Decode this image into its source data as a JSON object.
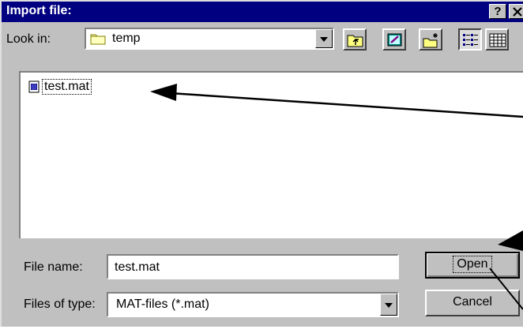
{
  "window": {
    "title": "Import file:",
    "help_label": "?",
    "close_label": "X"
  },
  "look_in": {
    "label": "Look in:",
    "value": "temp"
  },
  "toolbar": {
    "icons": [
      "up-one-level-icon",
      "desktop-icon",
      "new-folder-icon",
      "list-view-icon",
      "details-view-icon"
    ]
  },
  "files": [
    {
      "name": "test.mat",
      "icon": "mat-file-icon"
    }
  ],
  "file_name": {
    "label": "File name:",
    "value": "test.mat"
  },
  "files_of_type": {
    "label": "Files of type:",
    "value": "MAT-files (*.mat)"
  },
  "buttons": {
    "open": "Open",
    "cancel": "Cancel"
  },
  "colors": {
    "titlebar": "#000080",
    "face": "#c0c0c0"
  }
}
